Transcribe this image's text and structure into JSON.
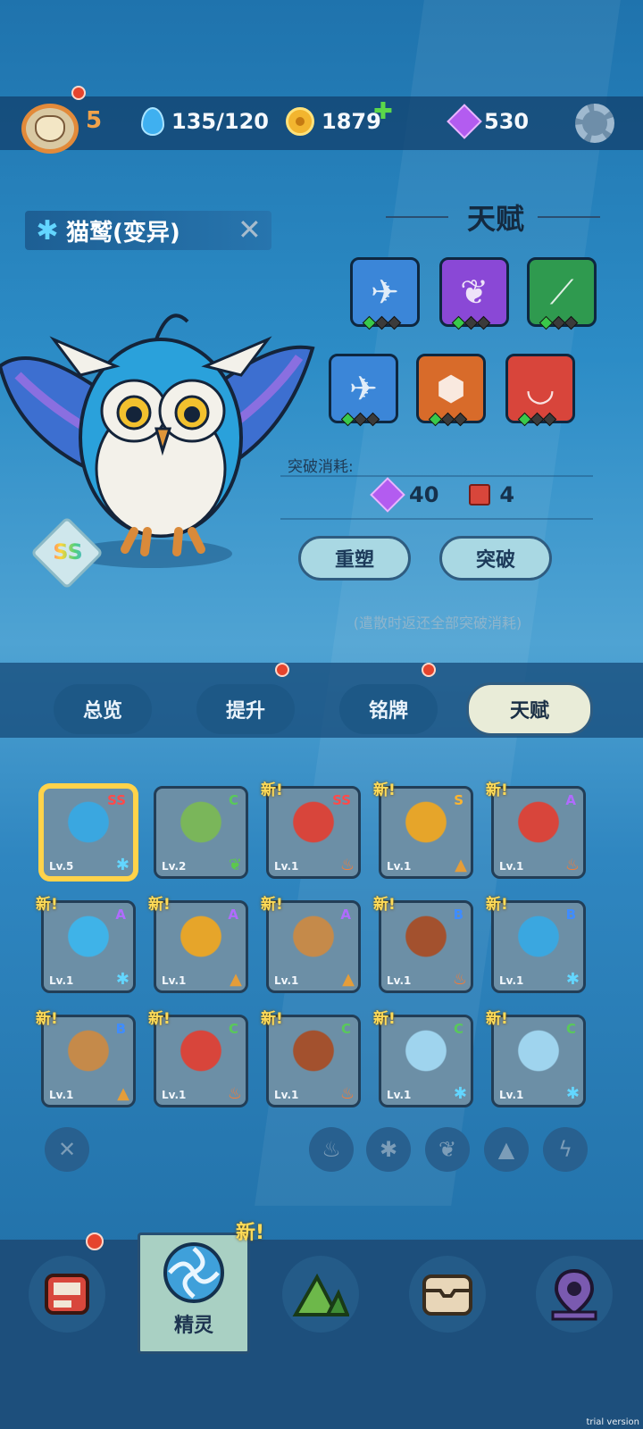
{
  "header": {
    "level": "5",
    "water": "135/120",
    "coins": "1879",
    "gems": "530"
  },
  "pet": {
    "name": "猫鹫(变异)",
    "rank": "SS"
  },
  "talent": {
    "title": "天赋",
    "cost_label": "突破消耗:",
    "cost_gem": "40",
    "cost_book": "4",
    "reshape_label": "重塑",
    "breakthrough_label": "突破",
    "hint": "(遣散时返还全部突破消耗)",
    "slots": [
      {
        "icon": "blue-bird-icon",
        "color": "#3b86d8",
        "pips": 1
      },
      {
        "icon": "purple-butterfly-icon",
        "color": "#8a48d6",
        "pips": 1
      },
      {
        "icon": "green-claw-icon",
        "color": "#2f9a4f",
        "pips": 1
      },
      {
        "icon": "blue-bird-icon",
        "color": "#3b86d8",
        "pips": 1
      },
      {
        "icon": "red-shield-icon",
        "color": "#d86b2a",
        "pips": 1
      },
      {
        "icon": "red-fang-icon",
        "color": "#d8453b",
        "pips": 1
      }
    ]
  },
  "tabs": {
    "overview": "总览",
    "upgrade": "提升",
    "plaque": "铭牌",
    "talent": "天赋"
  },
  "roster": [
    {
      "rank": "SS",
      "level": "Lv.5",
      "new": "",
      "element": "ice",
      "art": "owl"
    },
    {
      "rank": "C",
      "level": "Lv.2",
      "new": "",
      "element": "leaf",
      "art": "green-bird"
    },
    {
      "rank": "SS",
      "level": "Lv.1",
      "new": "新!",
      "element": "fire",
      "art": "red-horn"
    },
    {
      "rank": "S",
      "level": "Lv.1",
      "new": "新!",
      "element": "earth",
      "art": "sunflower"
    },
    {
      "rank": "A",
      "level": "Lv.1",
      "new": "新!",
      "element": "fire",
      "art": "red-horn"
    },
    {
      "rank": "A",
      "level": "Lv.1",
      "new": "新!",
      "element": "ice",
      "art": "blue-critter"
    },
    {
      "rank": "A",
      "level": "Lv.1",
      "new": "新!",
      "element": "earth",
      "art": "sunflower"
    },
    {
      "rank": "A",
      "level": "Lv.1",
      "new": "新!",
      "element": "earth",
      "art": "dog"
    },
    {
      "rank": "B",
      "level": "Lv.1",
      "new": "新!",
      "element": "fire",
      "art": "robot"
    },
    {
      "rank": "B",
      "level": "Lv.1",
      "new": "新!",
      "element": "ice",
      "art": "owl"
    },
    {
      "rank": "B",
      "level": "Lv.1",
      "new": "新!",
      "element": "earth",
      "art": "dog"
    },
    {
      "rank": "C",
      "level": "Lv.1",
      "new": "新!",
      "element": "fire",
      "art": "red-horn"
    },
    {
      "rank": "C",
      "level": "Lv.1",
      "new": "新!",
      "element": "fire",
      "art": "robot"
    },
    {
      "rank": "C",
      "level": "Lv.1",
      "new": "新!",
      "element": "ice",
      "art": "white-tiger"
    },
    {
      "rank": "C",
      "level": "Lv.1",
      "new": "新!",
      "element": "ice",
      "art": "white-tiger"
    }
  ],
  "nav": {
    "spirit_label": "精灵",
    "new_label": "新!"
  },
  "watermark": "trial version"
}
